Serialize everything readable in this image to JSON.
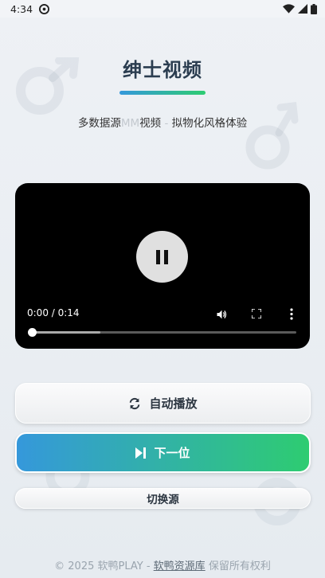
{
  "status_bar": {
    "time": "4:34"
  },
  "header": {
    "title": "绅士视频",
    "subtitle_main": "多数据源",
    "subtitle_dim": "MM",
    "subtitle_rest": "视频",
    "subtitle_sep": " - ",
    "subtitle_tail": "拟物化风格体验"
  },
  "player": {
    "time_display": "0:00 / 0:14",
    "progress_fraction": 0.0,
    "buffered_fraction": 0.26
  },
  "buttons": {
    "autoplay_label": "自动播放",
    "next_label": "下一位",
    "switch_source_label": "切换源"
  },
  "footer": {
    "copyright": "© 2025 软鸭PLAY - ",
    "link_text": "软鸭资源库",
    "rights": " 保留所有权利"
  },
  "colors": {
    "accent_start": "#3498db",
    "accent_end": "#2ecc71"
  },
  "icons": {
    "sync": "sync-icon",
    "next": "skip-next-icon",
    "pause": "pause-icon",
    "volume": "volume-icon",
    "fullscreen": "fullscreen-icon",
    "more": "more-vert-icon"
  }
}
